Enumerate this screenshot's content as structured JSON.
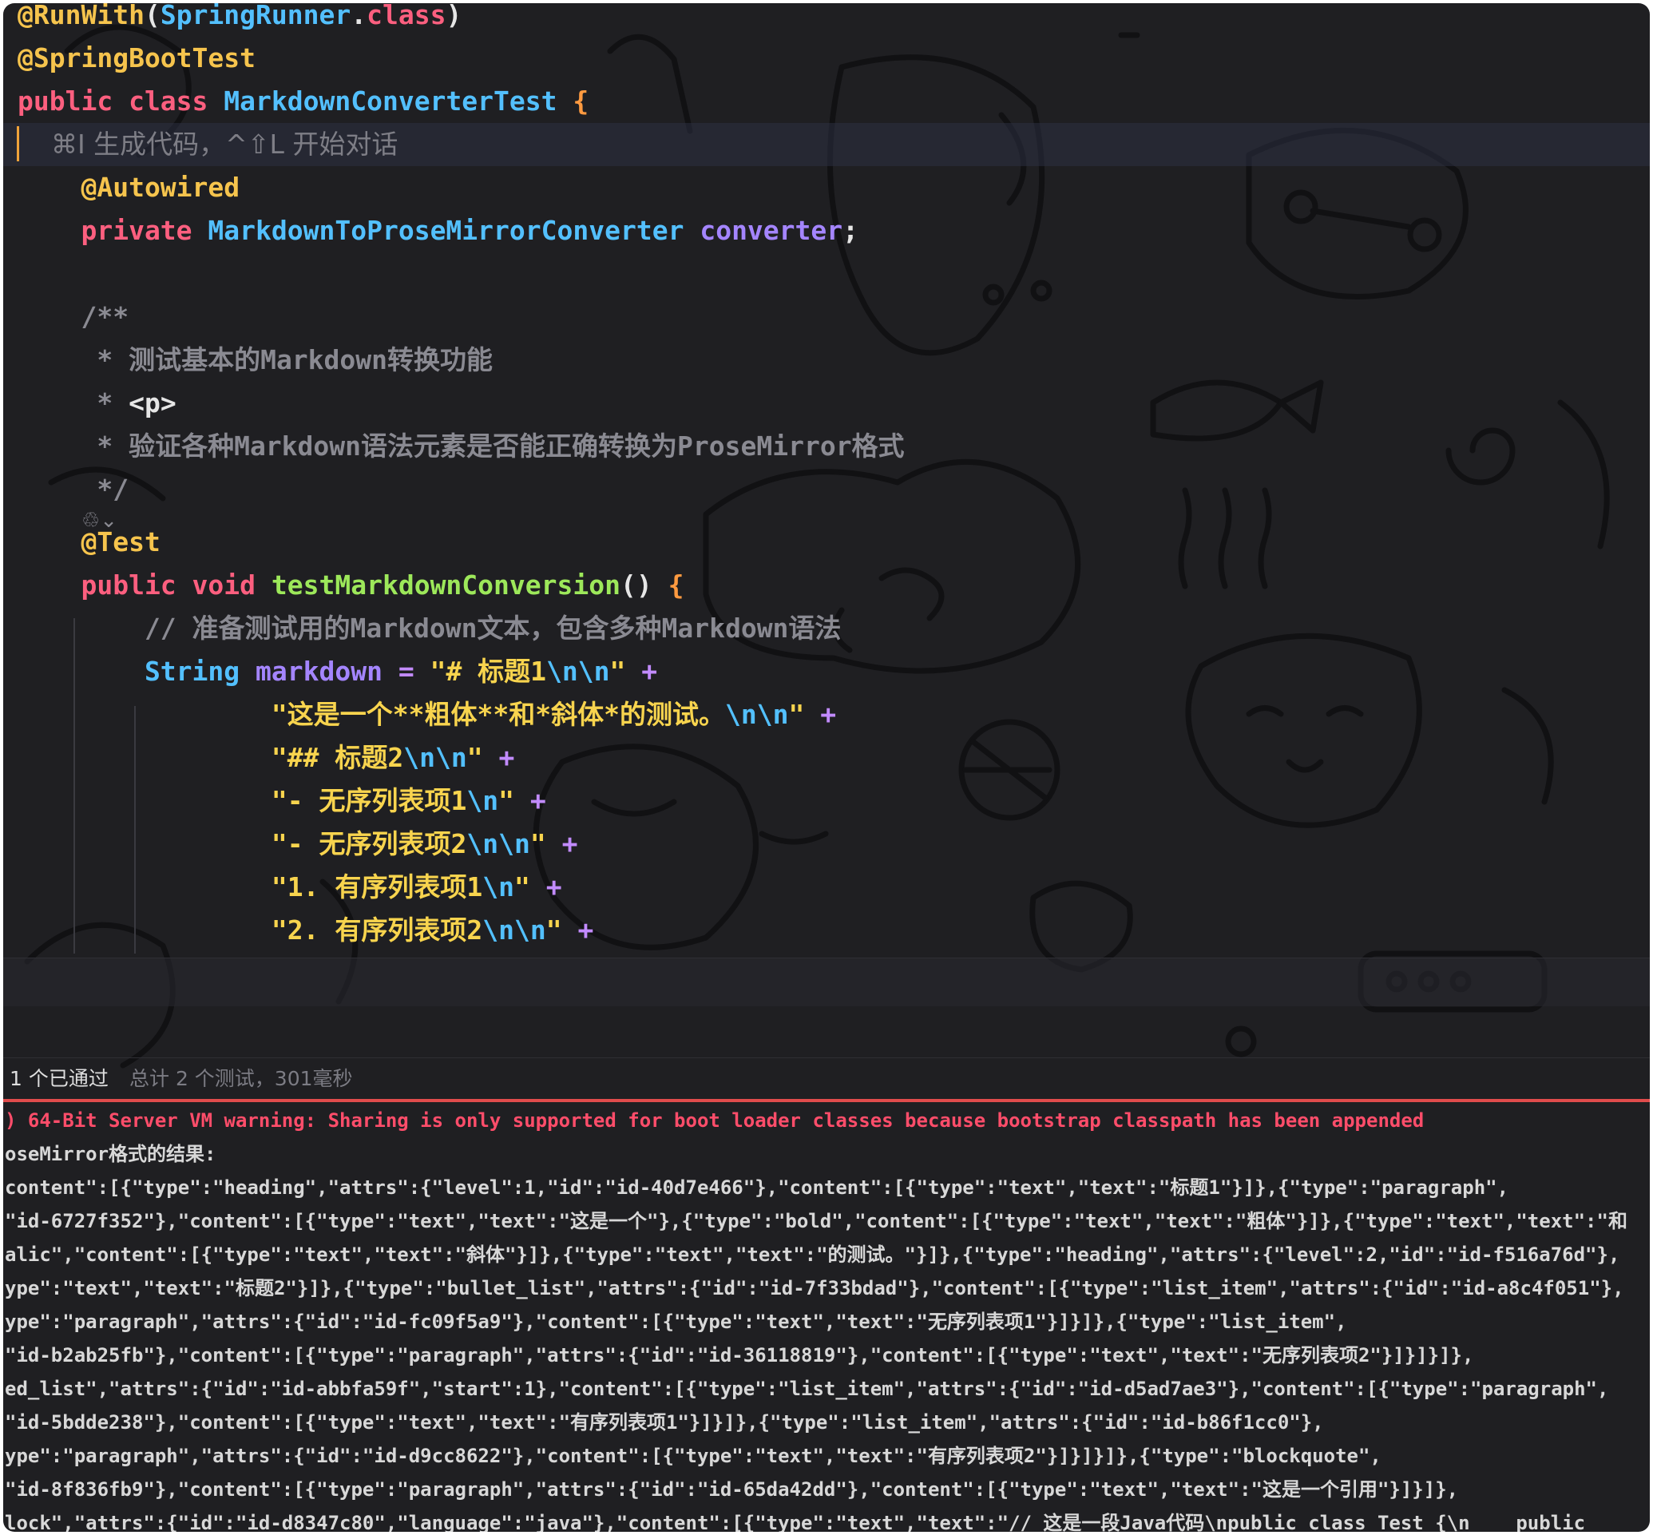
{
  "editor": {
    "lines": [
      {
        "parts": [
          {
            "cls": "anno",
            "t": "@RunWith"
          },
          {
            "cls": "punct",
            "t": "("
          },
          {
            "cls": "cls",
            "t": "SpringRunner"
          },
          {
            "cls": "punct",
            "t": "."
          },
          {
            "cls": "kw",
            "t": "class"
          },
          {
            "cls": "punct",
            "t": ")"
          }
        ]
      },
      {
        "parts": [
          {
            "cls": "anno",
            "t": "@SpringBootTest"
          }
        ]
      },
      {
        "parts": [
          {
            "cls": "kw",
            "t": "public class "
          },
          {
            "cls": "cls",
            "t": "MarkdownConverterTest "
          },
          {
            "cls": "brace",
            "t": "{"
          }
        ]
      },
      {
        "parts": [
          {
            "cls": "hint",
            "t": "    ⌘I 生成代码，^⇧L 开始对话"
          }
        ]
      },
      {
        "parts": [
          {
            "cls": "anno",
            "t": "    @Autowired"
          }
        ]
      },
      {
        "parts": [
          {
            "cls": "kw",
            "t": "    private "
          },
          {
            "cls": "cls",
            "t": "MarkdownToProseMirrorConverter "
          },
          {
            "cls": "field",
            "t": "converter"
          },
          {
            "cls": "punct",
            "t": ";"
          }
        ]
      },
      {
        "parts": [
          {
            "cls": "punct",
            "t": ""
          }
        ]
      },
      {
        "parts": [
          {
            "cls": "comment",
            "t": "    /**"
          }
        ]
      },
      {
        "parts": [
          {
            "cls": "comment",
            "t": "     * 测试基本的Markdown转换功能"
          }
        ]
      },
      {
        "parts": [
          {
            "cls": "comment",
            "t": "     * "
          },
          {
            "cls": "punct",
            "t": "<p>"
          }
        ]
      },
      {
        "parts": [
          {
            "cls": "comment",
            "t": "     * 验证各种Markdown语法元素是否能正确转换为ProseMirror格式"
          }
        ]
      },
      {
        "parts": [
          {
            "cls": "comment",
            "t": "     */"
          }
        ]
      },
      {
        "parts": [
          {
            "cls": "anno",
            "t": "    @Test"
          }
        ]
      },
      {
        "parts": [
          {
            "cls": "kw",
            "t": "    public void "
          },
          {
            "cls": "method",
            "t": "testMarkdownConversion"
          },
          {
            "cls": "punct",
            "t": "() "
          },
          {
            "cls": "brace",
            "t": "{"
          }
        ]
      },
      {
        "parts": [
          {
            "cls": "comment",
            "t": "        // 准备测试用的Markdown文本，包含多种Markdown语法"
          }
        ]
      },
      {
        "parts": [
          {
            "cls": "cls",
            "t": "        String "
          },
          {
            "cls": "field",
            "t": "markdown"
          },
          {
            "cls": "op",
            "t": " = "
          },
          {
            "cls": "str",
            "t": "\"# 标题1"
          },
          {
            "cls": "esc",
            "t": "\\n\\n"
          },
          {
            "cls": "str",
            "t": "\""
          },
          {
            "cls": "op",
            "t": " +"
          }
        ]
      },
      {
        "parts": [
          {
            "cls": "str",
            "t": "                \"这是一个**粗体**和*斜体*的测试。"
          },
          {
            "cls": "esc",
            "t": "\\n\\n"
          },
          {
            "cls": "str",
            "t": "\""
          },
          {
            "cls": "op",
            "t": " +"
          }
        ]
      },
      {
        "parts": [
          {
            "cls": "str",
            "t": "                \"## 标题2"
          },
          {
            "cls": "esc",
            "t": "\\n\\n"
          },
          {
            "cls": "str",
            "t": "\""
          },
          {
            "cls": "op",
            "t": " +"
          }
        ]
      },
      {
        "parts": [
          {
            "cls": "str",
            "t": "                \"- 无序列表项1"
          },
          {
            "cls": "esc",
            "t": "\\n"
          },
          {
            "cls": "str",
            "t": "\""
          },
          {
            "cls": "op",
            "t": " +"
          }
        ]
      },
      {
        "parts": [
          {
            "cls": "str",
            "t": "                \"- 无序列表项2"
          },
          {
            "cls": "esc",
            "t": "\\n\\n"
          },
          {
            "cls": "str",
            "t": "\""
          },
          {
            "cls": "op",
            "t": " +"
          }
        ]
      },
      {
        "parts": [
          {
            "cls": "str",
            "t": "                \"1. 有序列表项1"
          },
          {
            "cls": "esc",
            "t": "\\n"
          },
          {
            "cls": "str",
            "t": "\""
          },
          {
            "cls": "op",
            "t": " +"
          }
        ]
      },
      {
        "parts": [
          {
            "cls": "str",
            "t": "                \"2. 有序列表项2"
          },
          {
            "cls": "esc",
            "t": "\\n\\n"
          },
          {
            "cls": "str",
            "t": "\""
          },
          {
            "cls": "op",
            "t": " +"
          }
        ]
      }
    ],
    "gutter_icon": "♲⌄"
  },
  "status": {
    "passed": "1 个已通过",
    "total": "总计 2 个测试，301毫秒"
  },
  "console": {
    "lines": [
      {
        "warn": true,
        "t": ") 64-Bit Server VM warning: Sharing is only supported for boot loader classes because bootstrap classpath has been appended"
      },
      {
        "warn": false,
        "t": "oseMirror格式的结果:"
      },
      {
        "warn": false,
        "t": "content\":[{\"type\":\"heading\",\"attrs\":{\"level\":1,\"id\":\"id-40d7e466\"},\"content\":[{\"type\":\"text\",\"text\":\"标题1\"}]},{\"type\":\"paragraph\","
      },
      {
        "warn": false,
        "t": "\"id-6727f352\"},\"content\":[{\"type\":\"text\",\"text\":\"这是一个\"},{\"type\":\"bold\",\"content\":[{\"type\":\"text\",\"text\":\"粗体\"}]},{\"type\":\"text\",\"text\":\"和"
      },
      {
        "warn": false,
        "t": "alic\",\"content\":[{\"type\":\"text\",\"text\":\"斜体\"}]},{\"type\":\"text\",\"text\":\"的测试。\"}]},{\"type\":\"heading\",\"attrs\":{\"level\":2,\"id\":\"id-f516a76d\"},"
      },
      {
        "warn": false,
        "t": "ype\":\"text\",\"text\":\"标题2\"}]},{\"type\":\"bullet_list\",\"attrs\":{\"id\":\"id-7f33bdad\"},\"content\":[{\"type\":\"list_item\",\"attrs\":{\"id\":\"id-a8c4f051\"},"
      },
      {
        "warn": false,
        "t": "ype\":\"paragraph\",\"attrs\":{\"id\":\"id-fc09f5a9\"},\"content\":[{\"type\":\"text\",\"text\":\"无序列表项1\"}]}]},{\"type\":\"list_item\","
      },
      {
        "warn": false,
        "t": "\"id-b2ab25fb\"},\"content\":[{\"type\":\"paragraph\",\"attrs\":{\"id\":\"id-36118819\"},\"content\":[{\"type\":\"text\",\"text\":\"无序列表项2\"}]}]}]},"
      },
      {
        "warn": false,
        "t": "ed_list\",\"attrs\":{\"id\":\"id-abbfa59f\",\"start\":1},\"content\":[{\"type\":\"list_item\",\"attrs\":{\"id\":\"id-d5ad7ae3\"},\"content\":[{\"type\":\"paragraph\","
      },
      {
        "warn": false,
        "t": "\"id-5bdde238\"},\"content\":[{\"type\":\"text\",\"text\":\"有序列表项1\"}]}]},{\"type\":\"list_item\",\"attrs\":{\"id\":\"id-b86f1cc0\"},"
      },
      {
        "warn": false,
        "t": "ype\":\"paragraph\",\"attrs\":{\"id\":\"id-d9cc8622\"},\"content\":[{\"type\":\"text\",\"text\":\"有序列表项2\"}]}]}]},{\"type\":\"blockquote\","
      },
      {
        "warn": false,
        "t": "\"id-8f836fb9\"},\"content\":[{\"type\":\"paragraph\",\"attrs\":{\"id\":\"id-65da42dd\"},\"content\":[{\"type\":\"text\",\"text\":\"这是一个引用\"}]}]},"
      },
      {
        "warn": false,
        "t": "lock\",\"attrs\":{\"id\":\"id-d8347c80\",\"language\":\"java\"},\"content\":[{\"type\":\"text\",\"text\":\"// 这是一段Java代码\\npublic class Test {\\n    public"
      }
    ]
  },
  "colors": {
    "background": "#1f1f22",
    "keyword": "#fc5f7f",
    "annotation": "#f6c44d",
    "class": "#53c0ff",
    "string": "#f8d44e",
    "method": "#9de85a",
    "warning": "#ff4d6a",
    "divider": "#e04c4c"
  }
}
